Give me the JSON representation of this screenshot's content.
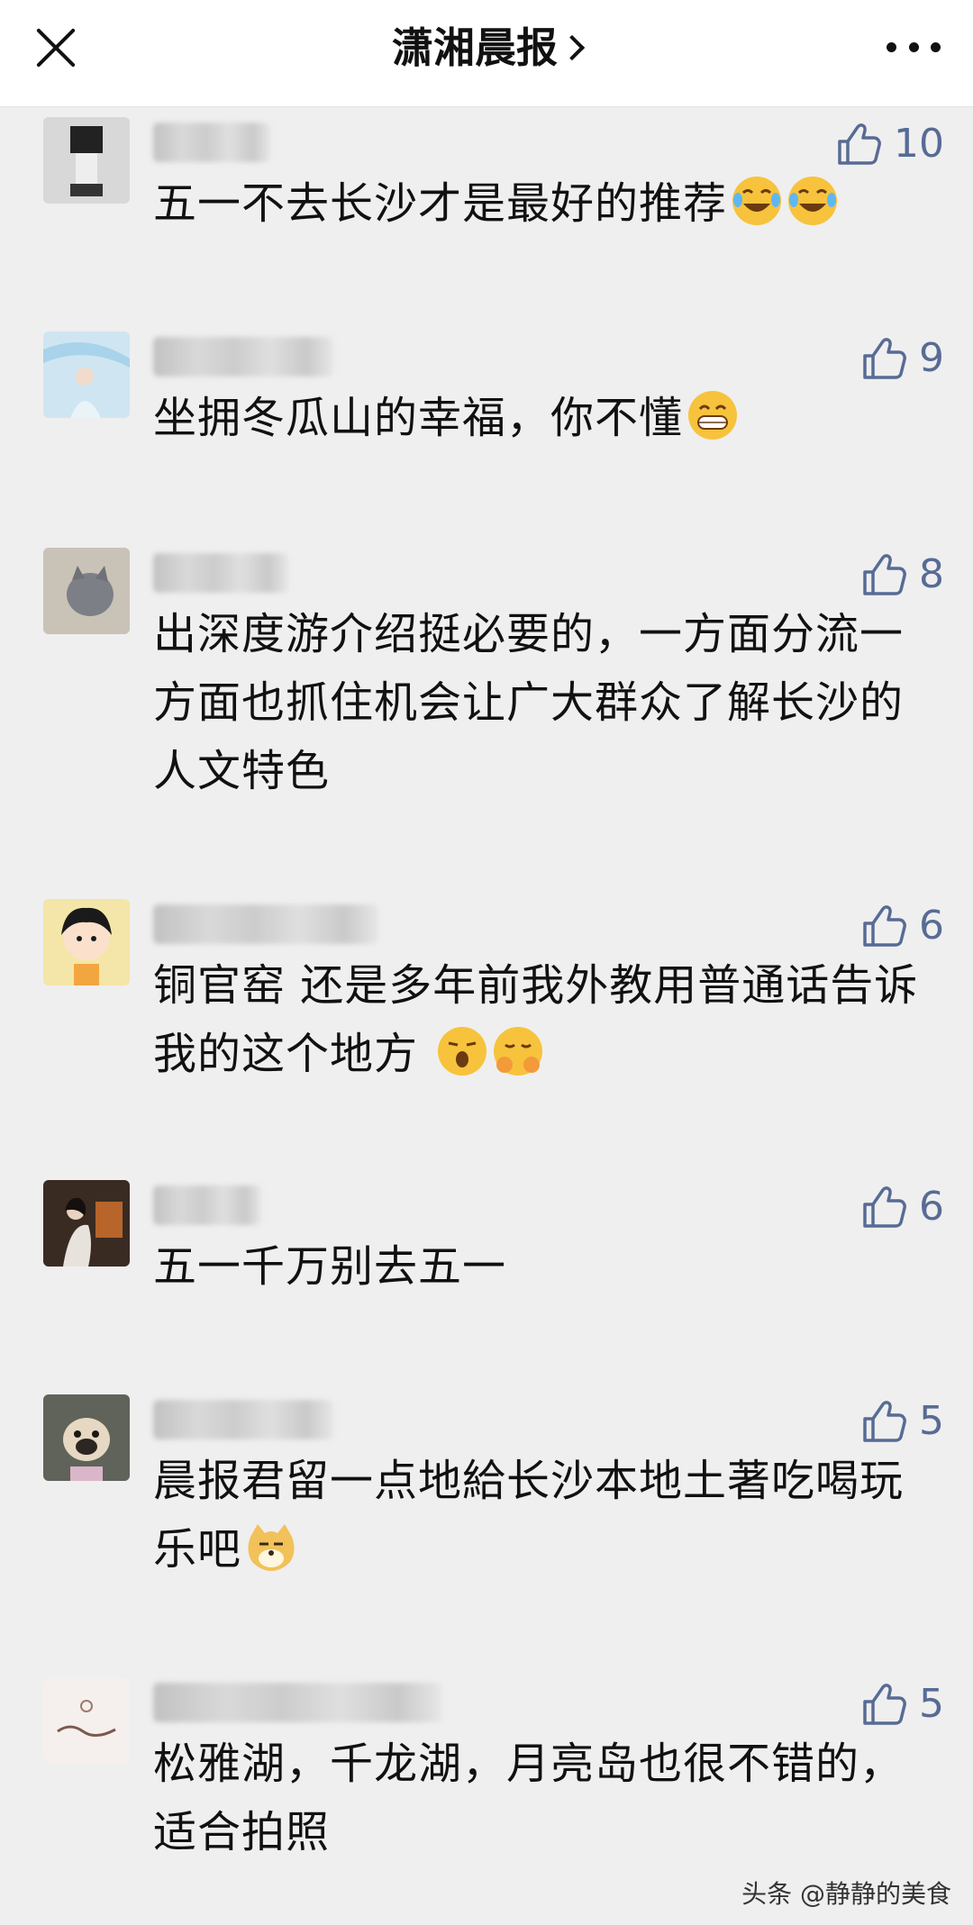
{
  "header": {
    "title": "潇湘晨报"
  },
  "comments": [
    {
      "text": "五一不去长沙才是最好的推荐",
      "likes": "10",
      "emojis": [
        "laugh-cry-emoji",
        "laugh-cry-emoji"
      ]
    },
    {
      "text": "坐拥冬瓜山的幸福，你不懂",
      "likes": "9",
      "emojis": [
        "grin-emoji"
      ]
    },
    {
      "text": "出深度游介绍挺必要的，一方面分流一方面也抓住机会让广大群众了解长沙的人文特色",
      "likes": "8",
      "emojis": []
    },
    {
      "text": "铜官窑 还是多年前我外教用普通话告诉我的这个地方",
      "likes": "6",
      "emojis": [
        "yawn-emoji",
        "shy-emoji"
      ]
    },
    {
      "text": "五一千万别去五一",
      "likes": "6",
      "emojis": []
    },
    {
      "text": "晨报君留一点地給长沙本地土著吃喝玩乐吧",
      "likes": "5",
      "emojis": [
        "doge-emoji"
      ]
    },
    {
      "text": "松雅湖，千龙湖，月亮岛也很不错的，适合拍照",
      "likes": "5",
      "emojis": []
    }
  ],
  "watermark": "头条 @静静的美食",
  "colors": {
    "like_color": "#576b95",
    "background": "#efefef",
    "header_bg": "#ffffff"
  }
}
